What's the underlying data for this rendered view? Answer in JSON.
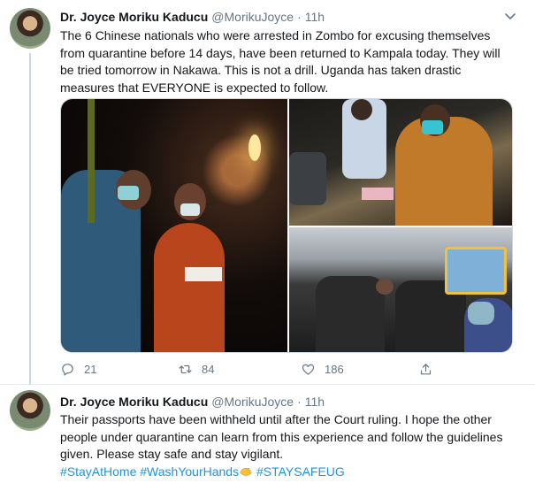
{
  "tweets": [
    {
      "author": "Dr. Joyce Moriku Kaducu",
      "handle": "@MorikuJoyce",
      "separator": "·",
      "time": "11h",
      "text": "The 6 Chinese nationals who were  arrested in Zombo for  excusing themselves from quarantine before 14 days, have been returned to Kampala today. They will be tried tomorrow in Nakawa. This is not a drill. Uganda has taken drastic measures that EVERYONE is expected to follow.",
      "replies": "21",
      "retweets": "84",
      "likes": "186"
    },
    {
      "author": "Dr. Joyce Moriku Kaducu",
      "handle": "@MorikuJoyce",
      "separator": "·",
      "time": "11h",
      "text": "Their passports have been withheld until after the Court ruling. I hope the other people under quarantine can learn from this experience and follow the guidelines given. Please stay safe and stay vigilant.",
      "hashtags": [
        "#StayAtHome",
        "#WashYourHands",
        "#STAYSAFEUG"
      ]
    }
  ],
  "colors": {
    "link": "#1b95e0",
    "secondary_text": "#657786",
    "divider": "#e6ecf0"
  },
  "icons": [
    "chevron-down-icon",
    "reply-icon",
    "retweet-icon",
    "like-icon",
    "share-icon",
    "clapping-hands-emoji"
  ]
}
